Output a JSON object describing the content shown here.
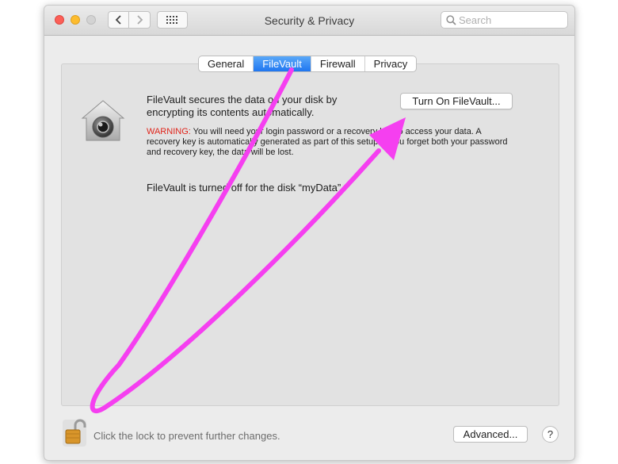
{
  "window": {
    "title": "Security & Privacy"
  },
  "search": {
    "placeholder": "Search"
  },
  "tabs": [
    {
      "label": "General"
    },
    {
      "label": "FileVault"
    },
    {
      "label": "Firewall"
    },
    {
      "label": "Privacy"
    }
  ],
  "filevault": {
    "description": "FileVault secures the data on your disk by encrypting its contents automatically.",
    "turn_on_label": "Turn On FileVault...",
    "warning_label": "WARNING:",
    "warning_text": " You will need your login password or a recovery key to access your data. A recovery key is automatically generated as part of this setup. If you forget both your password and recovery key, the data will be lost.",
    "status": "FileVault is turned off for the disk “myData”."
  },
  "footer": {
    "lock_text": "Click the lock to prevent further changes.",
    "advanced_label": "Advanced...",
    "help_label": "?"
  },
  "annotation": {
    "color": "#f53ff0"
  }
}
